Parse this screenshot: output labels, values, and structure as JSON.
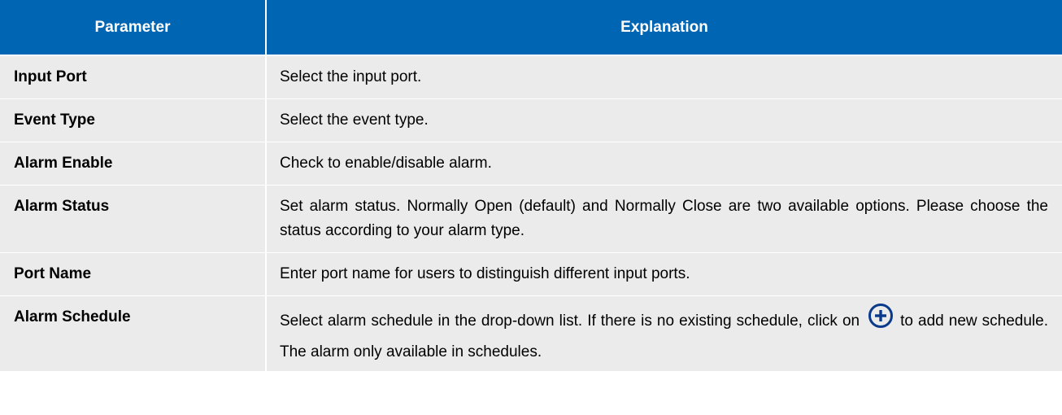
{
  "table": {
    "headers": {
      "parameter": "Parameter",
      "explanation": "Explanation"
    },
    "rows": [
      {
        "parameter": "Input Port",
        "explanation": "Select the input port."
      },
      {
        "parameter": "Event Type",
        "explanation": "Select the event type."
      },
      {
        "parameter": "Alarm Enable",
        "explanation": "Check to enable/disable alarm."
      },
      {
        "parameter": "Alarm Status",
        "explanation": "Set alarm status. Normally Open (default) and Normally Close are two available options. Please choose the status according to your alarm type."
      },
      {
        "parameter": "Port Name",
        "explanation": "Enter port name for users to distinguish different input ports."
      },
      {
        "parameter": "Alarm Schedule",
        "explanation_before_icon": "Select alarm schedule in the drop-down list. If there is no existing schedule, click on",
        "icon": "add-circle-icon",
        "explanation_after_icon": "to add new schedule. The alarm only available in schedules."
      }
    ]
  },
  "colors": {
    "header_background": "#0066b3",
    "header_text": "#ffffff",
    "row_background": "#ebebeb",
    "icon_color": "#0a3a8c"
  }
}
